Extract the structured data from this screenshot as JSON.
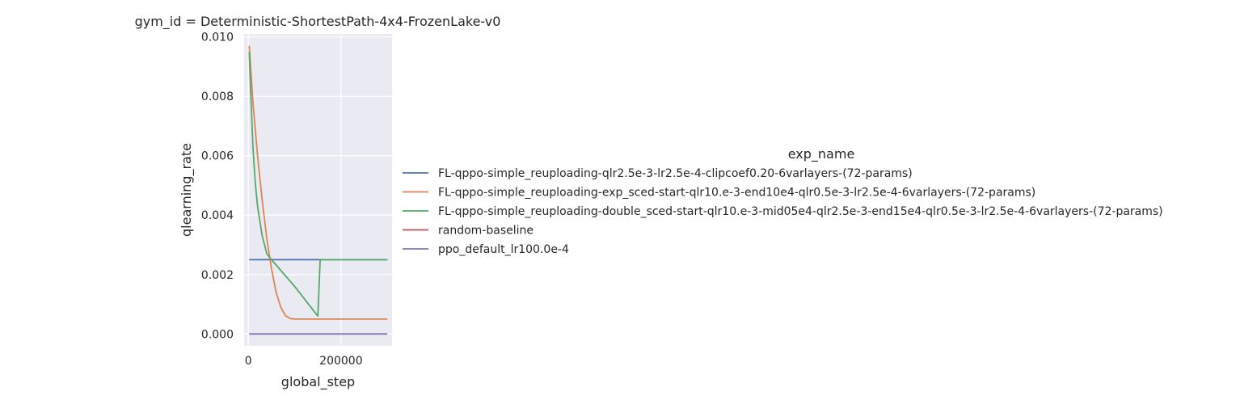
{
  "chart_data": {
    "type": "line",
    "title": "gym_id = Deterministic-ShortestPath-4x4-FrozenLake-v0",
    "xlabel": "global_step",
    "ylabel": "qlearning_rate",
    "xlim": [
      -9000,
      310000
    ],
    "ylim": [
      -0.0004,
      0.0101
    ],
    "xticks": [
      0,
      200000
    ],
    "xtick_labels": [
      "0",
      "200000"
    ],
    "yticks": [
      0.0,
      0.002,
      0.004,
      0.006,
      0.008,
      0.01
    ],
    "ytick_labels": [
      "0.000",
      "0.002",
      "0.004",
      "0.006",
      "0.008",
      "0.010"
    ],
    "grid": true,
    "legend_title": "exp_name",
    "legend_position": "right",
    "series": [
      {
        "name": "FL-qppo-simple_reuploading-qlr2.5e-3-lr2.5e-4-clipcoef0.20-6varlayers-(72-params)",
        "color": "#4c72b0",
        "x": [
          2048,
          300000
        ],
        "y": [
          0.0025,
          0.0025
        ]
      },
      {
        "name": "FL-qppo-simple_reuploading-exp_sced-start-qlr10.e-3-end10e4-qlr0.5e-3-lr2.5e-4-6varlayers-(72-params)",
        "color": "#dd8452",
        "x": [
          2048,
          10000,
          20000,
          30000,
          40000,
          50000,
          60000,
          70000,
          80000,
          90000,
          100000,
          300000
        ],
        "y": [
          0.0097,
          0.0078,
          0.006,
          0.0045,
          0.0032,
          0.0022,
          0.0014,
          0.0009,
          0.00062,
          0.00052,
          0.0005,
          0.0005
        ]
      },
      {
        "name": "FL-qppo-simple_reuploading-double_sced-start-qlr10.e-3-mid05e4-qlr2.5e-3-end15e4-qlr0.5e-3-lr2.5e-4-6varlayers-(72-params)",
        "color": "#55a868",
        "x": [
          2048,
          5000,
          10000,
          15000,
          20000,
          30000,
          40000,
          50000,
          100000,
          150000,
          155000,
          300000
        ],
        "y": [
          0.0095,
          0.0082,
          0.0063,
          0.0051,
          0.0043,
          0.0033,
          0.0027,
          0.0025,
          0.0016,
          0.0006,
          0.0025,
          0.0025
        ]
      },
      {
        "name": "random-baseline",
        "color": "#c44e52",
        "x": [],
        "y": []
      },
      {
        "name": "ppo_default_lr100.0e-4",
        "color": "#8172b3",
        "x": [
          2048,
          300000
        ],
        "y": [
          0.0,
          0.0
        ]
      }
    ]
  }
}
